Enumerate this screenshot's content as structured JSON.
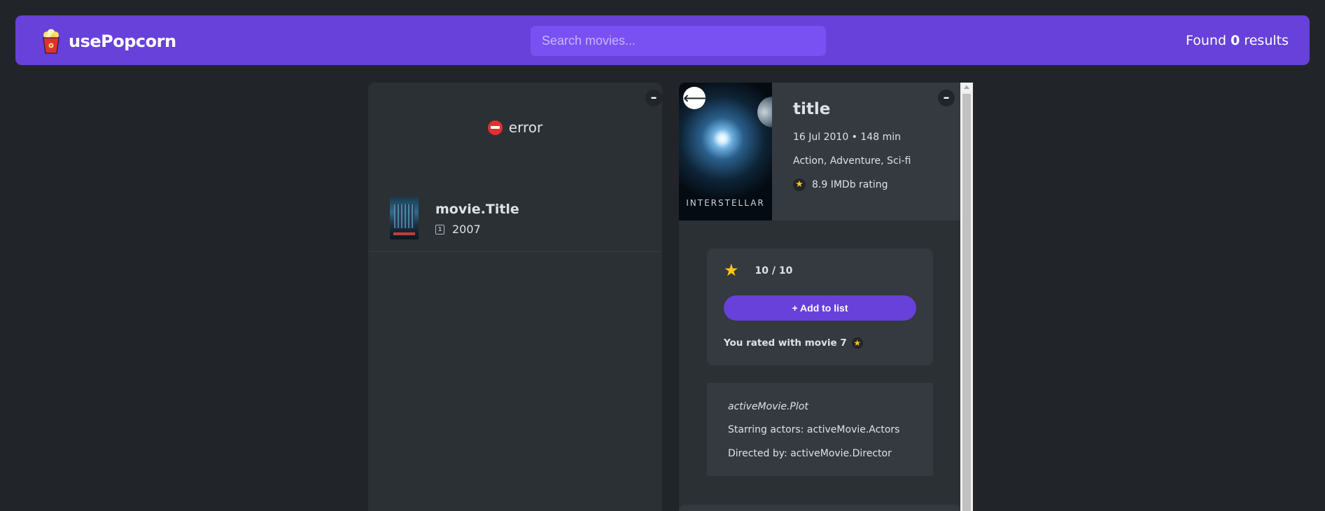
{
  "nav": {
    "logo_text": "usePopcorn",
    "search_placeholder": "Search movies...",
    "results_prefix": "Found",
    "results_count": "0",
    "results_suffix": "results"
  },
  "list_box": {
    "toggle_label": "–",
    "error_text": "error",
    "movies": [
      {
        "title": "movie.Title",
        "year": "2007",
        "year_icon": "calendar-icon"
      }
    ]
  },
  "details": {
    "toggle_label": "–",
    "back_label": "⟵",
    "poster_text": "INTERSTELLAR",
    "title": "title",
    "released_runtime": "16 Jul 2010 • 148 min",
    "genre": "Action, Adventure, Sci-fi",
    "imdb": "8.9 IMDb rating",
    "rating": {
      "star_icon": "star-icon",
      "value": "10 / 10",
      "add_button": "+ Add to list",
      "rated_text": "You rated with movie 7"
    },
    "plot": "activeMovie.Plot",
    "actors": "Starring actors: activeMovie.Actors",
    "director": "Directed by: activeMovie.Director"
  },
  "colors": {
    "background": "#212529",
    "nav": "#6741d9",
    "search": "#7950f2",
    "box": "#2b3035",
    "card": "#343a40",
    "star": "#fcc419",
    "error": "#e03131"
  }
}
